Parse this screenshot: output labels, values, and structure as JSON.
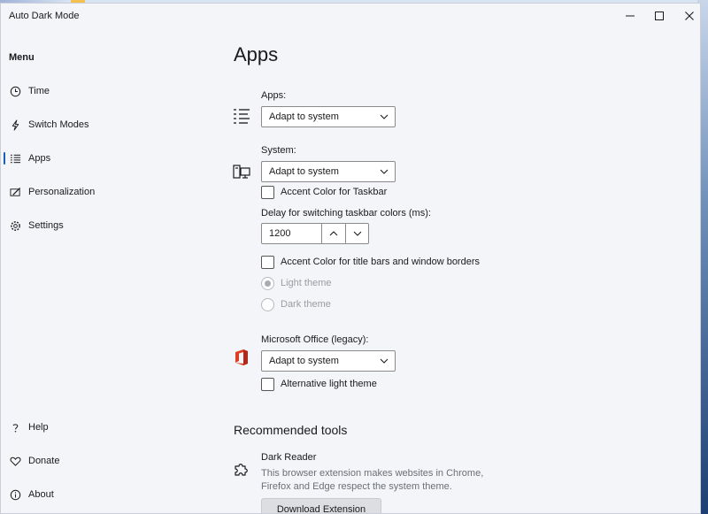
{
  "window": {
    "title": "Auto Dark Mode"
  },
  "sidebar": {
    "menu_title": "Menu",
    "items": [
      {
        "label": "Time",
        "icon": "clock-icon"
      },
      {
        "label": "Switch Modes",
        "icon": "lightning-icon"
      },
      {
        "label": "Apps",
        "icon": "list-icon",
        "active": true
      },
      {
        "label": "Personalization",
        "icon": "brush-icon"
      },
      {
        "label": "Settings",
        "icon": "gear-icon"
      }
    ],
    "bottom_items": [
      {
        "label": "Help",
        "icon": "question-icon"
      },
      {
        "label": "Donate",
        "icon": "heart-icon"
      },
      {
        "label": "About",
        "icon": "info-icon"
      }
    ]
  },
  "main": {
    "title": "Apps",
    "apps": {
      "label": "Apps:",
      "value": "Adapt to system"
    },
    "system": {
      "label": "System:",
      "value": "Adapt to system",
      "accent_taskbar_label": "Accent Color for Taskbar",
      "delay_label": "Delay for switching taskbar colors (ms):",
      "delay_value": "1200",
      "accent_titlebar_label": "Accent Color for title bars and window borders",
      "light_theme_label": "Light theme",
      "dark_theme_label": "Dark theme"
    },
    "office": {
      "label": "Microsoft Office (legacy):",
      "value": "Adapt to system",
      "alt_light_label": "Alternative light theme"
    },
    "recommended": {
      "title": "Recommended tools",
      "tool_name": "Dark Reader",
      "tool_desc": "This browser extension makes websites in Chrome, Firefox and Edge respect the system theme.",
      "button_label": "Download Extension"
    }
  },
  "colors": {
    "accent": "#1a5fb4",
    "office_red": "#e03c1f"
  }
}
